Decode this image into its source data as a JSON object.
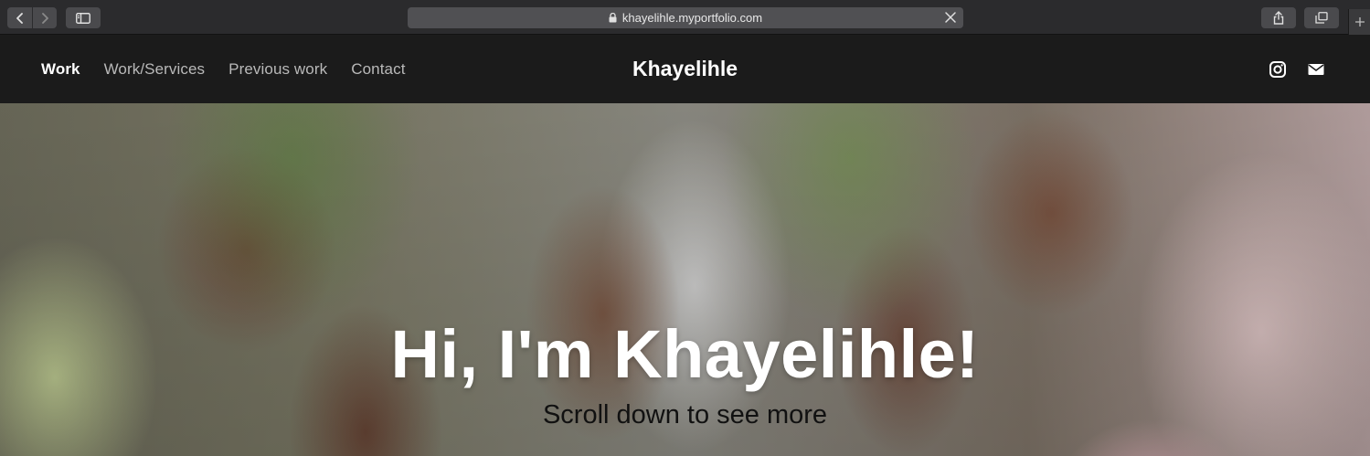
{
  "browser": {
    "url": "khayelihle.myportfolio.com"
  },
  "nav": {
    "items": [
      {
        "label": "Work",
        "active": true
      },
      {
        "label": "Work/Services",
        "active": false
      },
      {
        "label": "Previous work",
        "active": false
      },
      {
        "label": "Contact",
        "active": false
      }
    ]
  },
  "brand": "Khayelihle",
  "social": {
    "icons": [
      "instagram-icon",
      "mail-icon"
    ]
  },
  "hero": {
    "title": "Hi, I'm Khayelihle!",
    "subtitle": "Scroll down to see more"
  },
  "colors": {
    "header_bg": "#1b1b1b",
    "chrome_bg": "#2b2b2d",
    "nav_inactive": "#b9b9b9",
    "nav_active": "#ffffff"
  }
}
